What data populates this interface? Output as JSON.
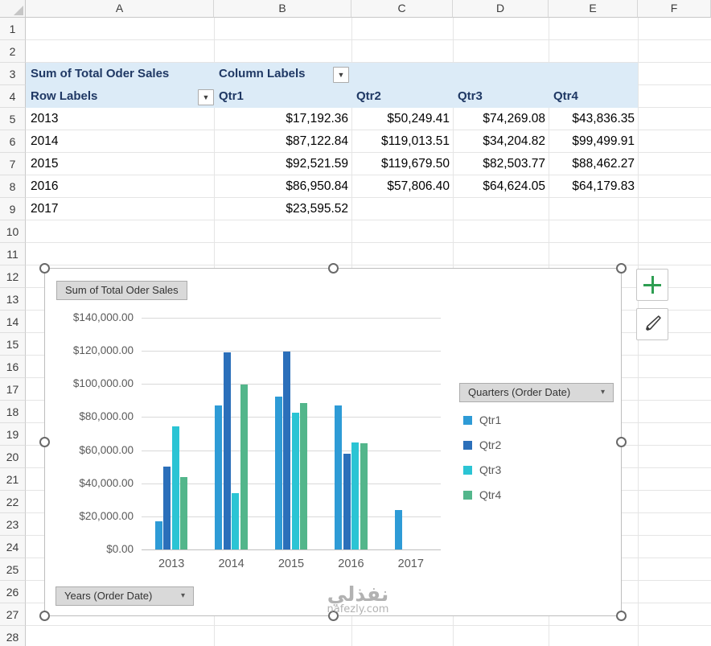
{
  "grid": {
    "column_headers": [
      "A",
      "B",
      "C",
      "D",
      "E",
      "F"
    ],
    "row_headers": [
      "1",
      "2",
      "3",
      "4",
      "5",
      "6",
      "7",
      "8",
      "9",
      "10",
      "11",
      "12",
      "13",
      "14",
      "15",
      "16",
      "17",
      "18",
      "19",
      "20",
      "21",
      "22",
      "23",
      "24",
      "25",
      "26",
      "27",
      "28"
    ]
  },
  "pivot_table": {
    "value_field_label": "Sum of Total Oder Sales",
    "column_labels": "Column Labels",
    "row_labels": "Row Labels",
    "columns": [
      "Qtr1",
      "Qtr2",
      "Qtr3",
      "Qtr4"
    ],
    "rows": [
      {
        "label": "2013",
        "values": [
          "$17,192.36",
          "$50,249.41",
          "$74,269.08",
          "$43,836.35"
        ]
      },
      {
        "label": "2014",
        "values": [
          "$87,122.84",
          "$119,013.51",
          "$34,204.82",
          "$99,499.91"
        ]
      },
      {
        "label": "2015",
        "values": [
          "$92,521.59",
          "$119,679.50",
          "$82,503.77",
          "$88,462.27"
        ]
      },
      {
        "label": "2016",
        "values": [
          "$86,950.84",
          "$57,806.40",
          "$64,624.05",
          "$64,179.83"
        ]
      },
      {
        "label": "2017",
        "values": [
          "$23,595.52",
          "",
          "",
          ""
        ]
      }
    ]
  },
  "chart": {
    "title_button": "Sum of Total Oder Sales",
    "legend_field_button": "Quarters (Order Date)",
    "axis_field_button": "Years (Order Date)",
    "dropdown_glyph": "▼"
  },
  "chart_data": {
    "type": "bar",
    "title": "Sum of Total Oder Sales",
    "categories": [
      "2013",
      "2014",
      "2015",
      "2016",
      "2017"
    ],
    "series": [
      {
        "name": "Qtr1",
        "color": "#2E9BD6",
        "values": [
          17192.36,
          87122.84,
          92521.59,
          86950.84,
          23595.52
        ]
      },
      {
        "name": "Qtr2",
        "color": "#2B6FBA",
        "values": [
          50249.41,
          119013.51,
          119679.5,
          57806.4,
          null
        ]
      },
      {
        "name": "Qtr3",
        "color": "#2BC4D4",
        "values": [
          74269.08,
          34204.82,
          82503.77,
          64624.05,
          null
        ]
      },
      {
        "name": "Qtr4",
        "color": "#53B68B",
        "values": [
          43836.35,
          99499.91,
          88462.27,
          64179.83,
          null
        ]
      }
    ],
    "ylim": [
      0,
      140000
    ],
    "ytick_step": 20000,
    "ytick_labels": [
      "$0.00",
      "$20,000.00",
      "$40,000.00",
      "$60,000.00",
      "$80,000.00",
      "$100,000.00",
      "$120,000.00",
      "$140,000.00"
    ],
    "legend_position": "right",
    "grid": true
  },
  "watermark": {
    "arabic": "نفذلي",
    "domain": "nafezly.com"
  }
}
